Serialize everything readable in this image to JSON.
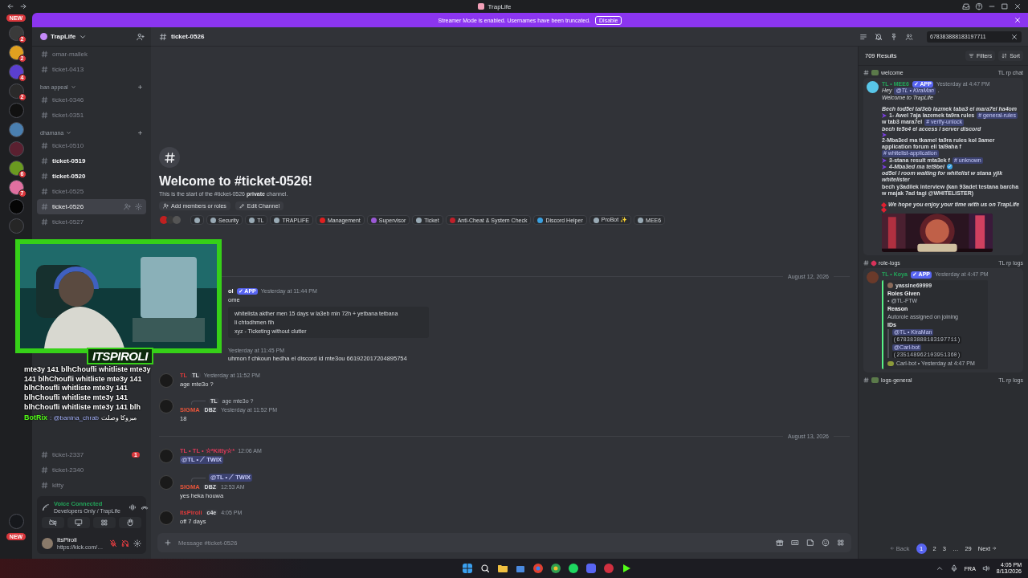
{
  "titlebar": {
    "title": "TrapLife"
  },
  "banner": {
    "text": "Streamer Mode is enabled. Usernames have been truncated.",
    "button": "Disable"
  },
  "servers": {
    "top_badge": "NEW",
    "bottom_badge": "NEW",
    "items": [
      {
        "color": "#3a3a3a",
        "badge": "2"
      },
      {
        "color": "#e0a020",
        "badge": "2"
      },
      {
        "color": "#5b3fd0",
        "badge": "4"
      },
      {
        "color": "#2a2a2a",
        "badge": "2"
      },
      {
        "color": "#111111"
      },
      {
        "color": "#4a7fb0"
      },
      {
        "color": "#5a2030"
      },
      {
        "color": "#6a9a20",
        "badge": "6"
      },
      {
        "color": "#e070a0",
        "badge": "7"
      },
      {
        "color": "#050505"
      },
      {
        "color": "#262626"
      }
    ],
    "bottom": [
      {
        "color": "#16181c"
      }
    ]
  },
  "sidebar": {
    "server": "TrapLife",
    "channels": [
      {
        "kind": "channel",
        "name": "omar-mallek",
        "unread": false,
        "selected": false
      },
      {
        "kind": "channel",
        "name": "ticket-0413",
        "unread": false,
        "selected": false
      },
      {
        "kind": "category",
        "name": "ban appeal"
      },
      {
        "kind": "channel",
        "name": "ticket-0346",
        "unread": false,
        "selected": false
      },
      {
        "kind": "channel",
        "name": "ticket-0351",
        "unread": false,
        "selected": false
      },
      {
        "kind": "category",
        "name": "dhamana"
      },
      {
        "kind": "channel",
        "name": "ticket-0510",
        "unread": false,
        "selected": false
      },
      {
        "kind": "channel",
        "name": "ticket-0519",
        "unread": true,
        "selected": false
      },
      {
        "kind": "channel",
        "name": "ticket-0520",
        "unread": true,
        "selected": false
      },
      {
        "kind": "channel",
        "name": "ticket-0525",
        "unread": false,
        "selected": false
      },
      {
        "kind": "channel",
        "name": "ticket-0526",
        "unread": false,
        "selected": true
      },
      {
        "kind": "channel",
        "name": "ticket-0527",
        "unread": false,
        "selected": false
      }
    ],
    "channels_lower": [
      {
        "kind": "channel",
        "name": "ticket-2337",
        "unread": false,
        "selected": false,
        "badge": "1"
      },
      {
        "kind": "channel",
        "name": "ticket-2340",
        "unread": false,
        "selected": false
      },
      {
        "kind": "channel",
        "name": "kitty",
        "unread": false,
        "selected": false
      }
    ],
    "voice": {
      "status": "Voice Connected",
      "channel": "Developers Only / TrapLife"
    },
    "user": {
      "name": "ItsPiroli",
      "status": "https://kick.com/…",
      "mic_muted": true,
      "deafened": true
    }
  },
  "stream_overlay": {
    "name": "ITSPIROLI",
    "chat": "mte3y 141 blhChoufli whitliste mte3y 141 blhChoufli whitliste mte3y 141 blhChoufli whitliste mte3y 141 blhChoufli whitliste mte3y 141 blhChoufli whitliste mte3y 141 blh",
    "chat_user": "BotRix",
    "chat_mention": ": @banina_chrab",
    "chat_text": "مبروكا وصلت"
  },
  "header": {
    "channel": "ticket-0526",
    "search": "678383888183197711"
  },
  "welcome": {
    "title": "Welcome to #ticket-0526!",
    "subtitle": "This is the start of the #ticket-0526 **private** channel.",
    "buttons": [
      "Add members or roles",
      "Edit Channel"
    ]
  },
  "roles": [
    {
      "color": "#99aab5"
    },
    {
      "name": "Security",
      "color": "#99aab5"
    },
    {
      "name": "TL",
      "color": "#99aab5"
    },
    {
      "name": "TRAPLIFE",
      "color": "#99aab5"
    },
    {
      "name": "Management",
      "color": "#e02020"
    },
    {
      "name": "Supervisor",
      "color": "#9b59d6"
    },
    {
      "name": "Ticket",
      "color": "#99aab5"
    },
    {
      "name": "Anti-Cheat & System Check",
      "color": "#c0202a"
    },
    {
      "name": "Discord Helper",
      "color": "#3aa0e0"
    },
    {
      "name": "ProBot ✨",
      "color": "#99aab5"
    },
    {
      "name": "MEE6",
      "color": "#99aab5"
    }
  ],
  "messages": [
    {
      "kind": "divider",
      "text": "August 12, 2026"
    },
    {
      "kind": "partial",
      "author": "ol",
      "badge": "✓ APP",
      "time": "Yesterday at 11:44 PM",
      "text": "ome",
      "embed": {
        "lines": [
          "whitelista akther men 15 days w la3eb min 72h + yetbana tetbana",
          "li chtodhmen fih"
        ],
        "footer": "xyz - Ticketing without clutter"
      }
    },
    {
      "kind": "partial",
      "time": "Yesterday at 11:45 PM",
      "text": "uhmon f chkoun hedha el discord id mte3ou 661922017204895754"
    },
    {
      "kind": "message",
      "author": "TL",
      "color": "#e03a3a",
      "tag": "TL",
      "time": "Yesterday at 11:52 PM",
      "text": "age mte3o ?"
    },
    {
      "kind": "message",
      "reply": {
        "tag": "TL",
        "text": "age mte3o ?"
      },
      "author": "SIGMA",
      "color": "#e8553a",
      "tag": "DBZ",
      "time": "Yesterday at 11:52 PM",
      "text": "18"
    },
    {
      "kind": "divider",
      "text": "August 13, 2026"
    },
    {
      "kind": "message",
      "author": "TL • TL • ☆*Kitty☆*",
      "color": "#e03a5a",
      "time": "12:06 AM",
      "mention": "@TL • ⟋ TWIX"
    },
    {
      "kind": "message",
      "reply": {
        "mention": "@TL • ⟋ TWIX"
      },
      "author": "SIGMA",
      "color": "#e8553a",
      "tag": "DBZ",
      "time": "12:53 AM",
      "text": "yes heka houwa"
    },
    {
      "kind": "message",
      "author": "ItsPiroli",
      "color": "#e03a3a",
      "tag": "c4e",
      "time": "4:05 PM",
      "text": "off 7 days"
    }
  ],
  "composer": {
    "placeholder": "Message #ticket-0526"
  },
  "search_panel": {
    "count": "709 Results",
    "filters": "Filters",
    "sort": "Sort",
    "results": [
      {
        "channel": "welcome",
        "category": "TL rp chat",
        "author": "TL • MEE6",
        "badge": "✓ APP",
        "time": "Yesterday at 4:47 PM",
        "paragraphs": [
          {
            "kind": "italic",
            "parts": [
              {
                "kind": "text",
                "text": "Hey"
              },
              {
                "kind": "mention",
                "text": "@TL • KiraMan"
              },
              {
                "kind": "text",
                "text": "."
              }
            ]
          },
          {
            "kind": "italic",
            "parts": [
              {
                "kind": "text",
                "text": "Welcome to TrapLife"
              }
            ]
          },
          {
            "kind": "bolditalic",
            "break_before": true,
            "parts": [
              {
                "kind": "text",
                "text": "Bech tod5el tal3eb lazmek taba3 el mara7el ha4om"
              }
            ]
          },
          {
            "kind": "bold",
            "bullet": true,
            "parts": [
              {
                "kind": "text",
                "text": "1- Awel 7aja lazemek ta9ra rules"
              },
              {
                "kind": "channel",
                "text": "# general-rules"
              },
              {
                "kind": "text",
                "text": "w tab3 mara7el"
              },
              {
                "kind": "channel",
                "text": "# verify-unlock"
              },
              {
                "kind": "emphasis",
                "text": "bech te5e4 el access l server discord"
              }
            ]
          },
          {
            "kind": "bold",
            "bullet": true,
            "parts": [
              {
                "kind": "text",
                "text": "2-Mba3ed ma tkamel ta9ra rules kol 3amer application forum eli tal9aha f"
              },
              {
                "kind": "channel",
                "text": "# whitelist-application"
              }
            ]
          },
          {
            "kind": "bold",
            "bullet": true,
            "parts": [
              {
                "kind": "text",
                "text": "3-stana result mta3ek f"
              },
              {
                "kind": "channel",
                "text": "# unknown"
              }
            ]
          },
          {
            "kind": "bolditalic",
            "bullet": true,
            "parts": [
              {
                "kind": "text",
                "text": "4-Mba3ed ma tet9bel"
              },
              {
                "kind": "check"
              },
              {
                "kind": "text",
                "text": "od5el l room waiting for whitelist w stana yjik whitelister"
              }
            ]
          },
          {
            "kind": "bold",
            "parts": [
              {
                "kind": "text",
                "text": "bech y3adilek interview (kan 93adet testana barcha w majak 7ad tagi @WHITELISTER)"
              }
            ]
          },
          {
            "kind": "bolditalic",
            "break_before": true,
            "parts": [
              {
                "kind": "heart"
              },
              {
                "kind": "text",
                "text": "We hope you enjoy your time with us on TrapLife"
              },
              {
                "kind": "heart"
              }
            ]
          }
        ]
      },
      {
        "channel": "role-logs",
        "category": "TL rp logs",
        "author": "TL • Koya",
        "badge": "✓ APP",
        "time": "Yesterday at 4:47 PM",
        "embed": {
          "author": "yassine69999",
          "fields": [
            {
              "name": "Roles Given",
              "value": "• @TL-FTW"
            },
            {
              "name": "Reason",
              "value": "Autorole assigned on joining"
            }
          ],
          "ids_title": "IDs",
          "ids": [
            {
              "kind": "mention",
              "text": "@TL • KiraMan"
            },
            {
              "kind": "code",
              "text": "(678383888183197711)"
            },
            {
              "kind": "mention",
              "text": "@Carl-bot"
            },
            {
              "kind": "code",
              "text": "(235148962103951360)"
            }
          ],
          "footer": "Carl-bot • Yesterday at 4:47 PM"
        }
      },
      {
        "channel": "logs-general",
        "category": "TL rp logs"
      }
    ],
    "pages": [
      {
        "label": "Back",
        "kind": "back"
      },
      {
        "label": "1",
        "kind": "page",
        "selected": true
      },
      {
        "label": "2",
        "kind": "page",
        "selected": false
      },
      {
        "label": "3",
        "kind": "page",
        "selected": false
      },
      {
        "label": "…",
        "kind": "gap"
      },
      {
        "label": "29",
        "kind": "page",
        "selected": false
      },
      {
        "label": "Next",
        "kind": "next"
      }
    ]
  },
  "taskbar": {
    "language": "FRA",
    "time": "4:05 PM",
    "date": "8/13/2026"
  }
}
